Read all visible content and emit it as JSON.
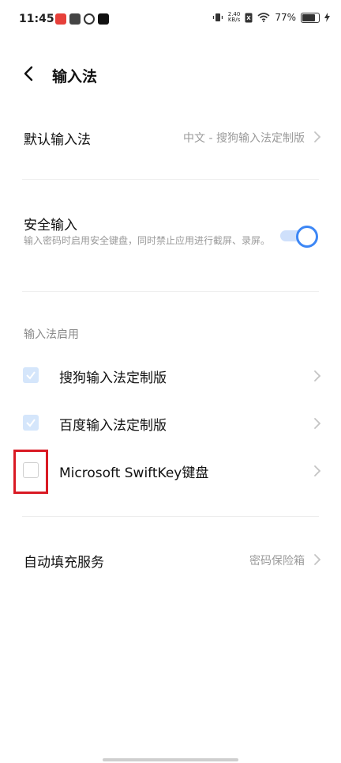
{
  "status_bar": {
    "time": "11:45",
    "net_speed_value": "2.40",
    "net_speed_unit": "KB/s",
    "battery_text": "77%",
    "app_icons": [
      "redbook-icon",
      "store-icon",
      "link-icon",
      "tiktok-icon"
    ]
  },
  "header": {
    "title": "输入法"
  },
  "default_input": {
    "label": "默认输入法",
    "value": "中文 - 搜狗输入法定制版"
  },
  "secure_input": {
    "label": "安全输入",
    "description": "输入密码时启用安全键盘，同时禁止应用进行截屏、录屏。",
    "enabled": true
  },
  "ime_section": {
    "title": "输入法启用",
    "items": [
      {
        "label": "搜狗输入法定制版",
        "checked": true
      },
      {
        "label": "百度输入法定制版",
        "checked": true
      },
      {
        "label": "Microsoft SwiftKey键盘",
        "checked": false
      }
    ]
  },
  "autofill": {
    "label": "自动填充服务",
    "value": "密码保险箱"
  },
  "colors": {
    "accent": "#3d87f5",
    "checked_bg": "#d5e6fb",
    "highlight": "#d91a24"
  }
}
